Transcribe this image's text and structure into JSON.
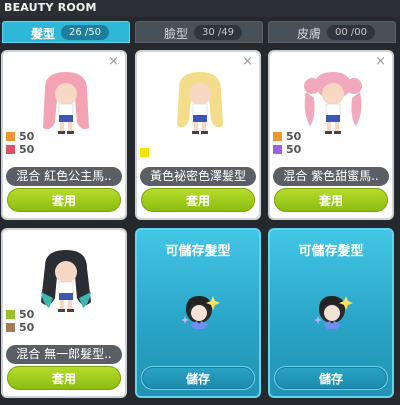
{
  "window_title": "BEAUTY ROOM",
  "tabs": [
    {
      "label": "髮型",
      "count": "26 /50",
      "active": true
    },
    {
      "label": "臉型",
      "count": "30 /49",
      "active": false
    },
    {
      "label": "皮膚",
      "count": "00 /00",
      "active": false
    }
  ],
  "cards": [
    {
      "name": "混合 紅色公主馬..",
      "colors": [
        {
          "color": "#f0962e",
          "value": "50"
        },
        {
          "color": "#e0506a",
          "value": "50"
        }
      ],
      "button": "套用",
      "close": "×",
      "hair_color": "#f4a3b4"
    },
    {
      "name": "黃色袐密色澤髮型",
      "colors": [
        {
          "color": "#f2e600",
          "value": ""
        }
      ],
      "button": "套用",
      "close": "×",
      "hair_color": "#f4dd8a"
    },
    {
      "name": "混合 紫色甜蜜馬..",
      "colors": [
        {
          "color": "#f0962e",
          "value": "50"
        },
        {
          "color": "#a060e0",
          "value": "50"
        }
      ],
      "button": "套用",
      "close": "×",
      "hair_color": "#f2a8bf"
    },
    {
      "name": "混合 無一郎髮型..",
      "colors": [
        {
          "color": "#9ac02a",
          "value": "50"
        },
        {
          "color": "#a57a52",
          "value": "50"
        }
      ],
      "button": "套用",
      "close": "",
      "hair_color": "#2a2d33"
    }
  ],
  "empty_slots": [
    {
      "title": "可儲存髮型",
      "button": "儲存"
    },
    {
      "title": "可儲存髮型",
      "button": "儲存"
    }
  ],
  "colors": {
    "tab_active": "#2fb7d8",
    "apply_button": "#9dcc1c",
    "save_button": "#1f8fb0"
  }
}
